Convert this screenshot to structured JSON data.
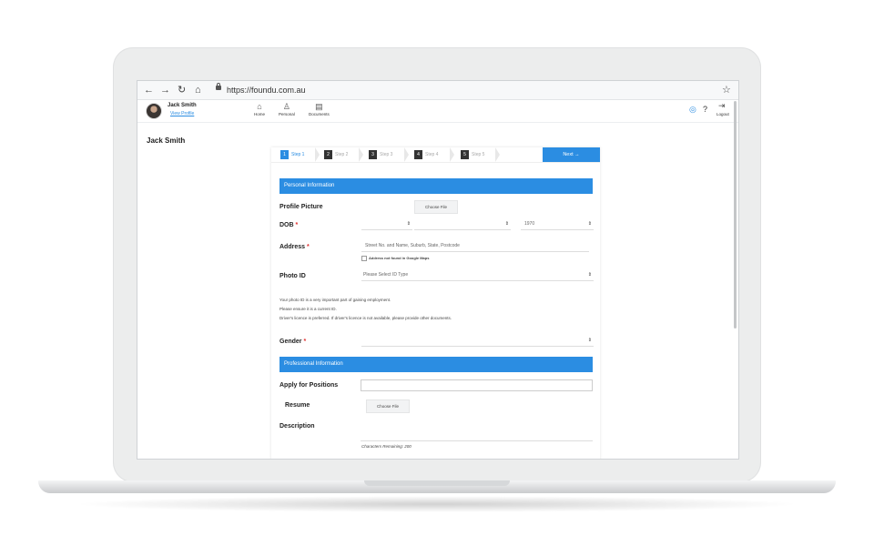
{
  "browser": {
    "url": "https://foundu.com.au",
    "back_icon": "arrow-left-icon",
    "forward_icon": "arrow-right-icon",
    "reload_icon": "reload-icon",
    "home_icon": "home-icon",
    "star_icon": "star-icon"
  },
  "nav": {
    "user_name": "Jack Smith",
    "view_profile": "View Profile",
    "items": [
      {
        "label": "Home",
        "icon": "home-icon"
      },
      {
        "label": "Personal",
        "icon": "person-icon"
      },
      {
        "label": "Documents",
        "icon": "document-icon"
      }
    ],
    "logout": "Logout"
  },
  "page": {
    "user_heading": "Jack Smith"
  },
  "steps": [
    {
      "num": "1",
      "label": "Step 1",
      "active": true
    },
    {
      "num": "2",
      "label": "Step 2"
    },
    {
      "num": "3",
      "label": "Step 3"
    },
    {
      "num": "4",
      "label": "Step 4"
    },
    {
      "num": "5",
      "label": "Step 5"
    }
  ],
  "next_label": "Next →",
  "personal": {
    "section_title": "Personal Information",
    "profile_picture_label": "Profile Picture",
    "choose_file": "Choose File",
    "dob_label": "DOB",
    "dob_year": "1970",
    "address_label": "Address",
    "address_placeholder": "Street No. and Name, Suburb, State, Postcode",
    "address_checkbox": "Address not found in Google Maps",
    "photo_id_label": "Photo ID",
    "photo_id_placeholder": "Please Select ID Type",
    "photo_id_note_1": "Your photo ID is a very important part of gaining employment.",
    "photo_id_note_2": "Please ensure it is a current ID.",
    "photo_id_note_3": "Driver's licence is preferred. If driver's licence is not available, please provide other documents.",
    "gender_label": "Gender",
    "required_mark": "*"
  },
  "professional": {
    "section_title": "Professional Information",
    "apply_label": "Apply for Positions",
    "resume_label": "Resume",
    "choose_file": "Choose File",
    "description_label": "Description",
    "chars_remaining": "Characters Remaining: 200"
  },
  "colors": {
    "accent": "#2b8de2",
    "required": "#e0302f"
  }
}
